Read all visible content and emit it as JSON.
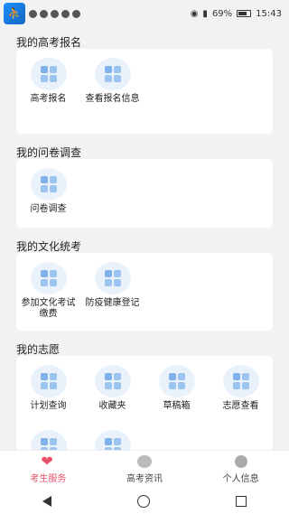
{
  "status_bar": {
    "battery": "69%",
    "time": "15:43"
  },
  "sections": [
    {
      "title": "我的高考报名",
      "items": [
        "高考报名",
        "查看报名信息"
      ]
    },
    {
      "title": "我的问卷调查",
      "items": [
        "问卷调查"
      ]
    },
    {
      "title": "我的文化统考",
      "items": [
        "参加文化考试缴费",
        "防疫健康登记"
      ]
    },
    {
      "title": "我的志愿",
      "items": [
        "计划查询",
        "收藏夹",
        "草稿箱",
        "志愿查看"
      ]
    }
  ],
  "bottom_nav": {
    "tabs": [
      {
        "label": "考生服务",
        "icon": "heart-icon",
        "active": true
      },
      {
        "label": "高考资讯",
        "icon": "chat-bubble-icon",
        "active": false
      },
      {
        "label": "个人信息",
        "icon": "person-icon",
        "active": false
      }
    ]
  },
  "colors": {
    "accent": "#e8506a",
    "icon_bg": "#e9f1fb",
    "icon_fg": "#9cc4f0"
  }
}
